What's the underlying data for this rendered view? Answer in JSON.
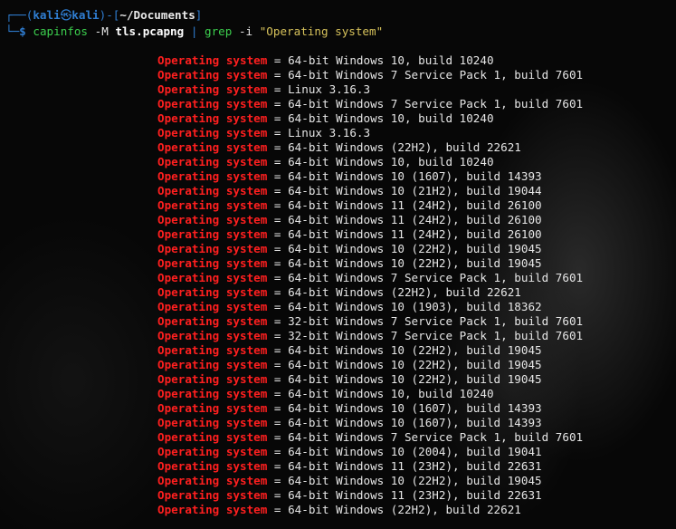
{
  "prompt": {
    "frame_open": "┌──(",
    "user": "kali",
    "skull_icon": "㉿",
    "host": "kali",
    "frame_mid": ")-[",
    "path": "~/Documents",
    "frame_close": "]",
    "cmd_prefix": "└─",
    "dollar": "$",
    "command": "capinfos",
    "flag": "-M",
    "file": "tls.pcapng",
    "pipe": "|",
    "grep": "grep",
    "grep_flag": "-i",
    "pattern": "\"Operating system\""
  },
  "output_key": "Operating system",
  "output_sep": " = ",
  "output_lines": [
    "64-bit Windows 10, build 10240",
    "64-bit Windows 7 Service Pack 1, build 7601",
    "Linux 3.16.3",
    "64-bit Windows 7 Service Pack 1, build 7601",
    "64-bit Windows 10, build 10240",
    "Linux 3.16.3",
    "64-bit Windows (22H2), build 22621",
    "64-bit Windows 10, build 10240",
    "64-bit Windows 10 (1607), build 14393",
    "64-bit Windows 10 (21H2), build 19044",
    "64-bit Windows 11 (24H2), build 26100",
    "64-bit Windows 11 (24H2), build 26100",
    "64-bit Windows 11 (24H2), build 26100",
    "64-bit Windows 10 (22H2), build 19045",
    "64-bit Windows 10 (22H2), build 19045",
    "64-bit Windows 7 Service Pack 1, build 7601",
    "64-bit Windows (22H2), build 22621",
    "64-bit Windows 10 (1903), build 18362",
    "32-bit Windows 7 Service Pack 1, build 7601",
    "32-bit Windows 7 Service Pack 1, build 7601",
    "64-bit Windows 10 (22H2), build 19045",
    "64-bit Windows 10 (22H2), build 19045",
    "64-bit Windows 10 (22H2), build 19045",
    "64-bit Windows 10, build 10240",
    "64-bit Windows 10 (1607), build 14393",
    "64-bit Windows 10 (1607), build 14393",
    "64-bit Windows 7 Service Pack 1, build 7601",
    "64-bit Windows 10 (2004), build 19041",
    "64-bit Windows 11 (23H2), build 22631",
    "64-bit Windows 10 (22H2), build 19045",
    "64-bit Windows 11 (23H2), build 22631",
    "64-bit Windows (22H2), build 22621"
  ]
}
